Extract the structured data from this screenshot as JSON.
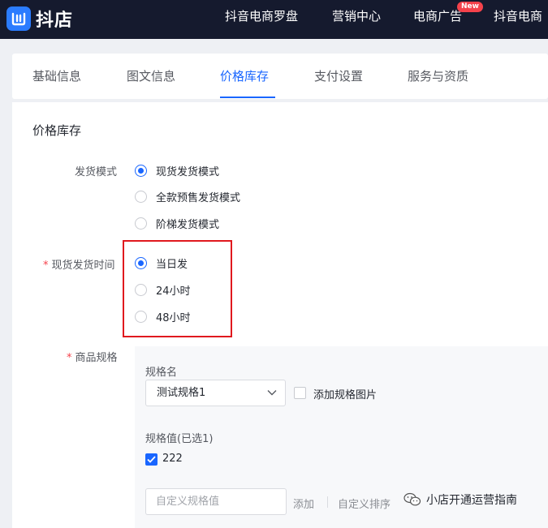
{
  "header": {
    "logo_text": "抖店",
    "nav": [
      "抖音电商罗盘",
      "营销中心",
      "电商广告",
      "抖音电商"
    ],
    "badge": "New"
  },
  "tabs": [
    {
      "label": "基础信息",
      "active": false
    },
    {
      "label": "图文信息",
      "active": false
    },
    {
      "label": "价格库存",
      "active": true
    },
    {
      "label": "支付设置",
      "active": false
    },
    {
      "label": "服务与资质",
      "active": false
    }
  ],
  "section_title": "价格库存",
  "delivery_mode": {
    "label": "发货模式",
    "options": [
      {
        "label": "现货发货模式",
        "checked": true
      },
      {
        "label": "全款预售发货模式",
        "checked": false
      },
      {
        "label": "阶梯发货模式",
        "checked": false
      }
    ]
  },
  "delivery_time": {
    "required_mark": "*",
    "label": "现货发货时间",
    "options": [
      {
        "label": "当日发",
        "checked": true
      },
      {
        "label": "24小时",
        "checked": false
      },
      {
        "label": "48小时",
        "checked": false
      }
    ]
  },
  "spec": {
    "required_mark": "*",
    "label": "商品规格",
    "name_label": "规格名",
    "name_value": "测试规格1",
    "add_image_label": "添加规格图片",
    "values_label": "规格值(已选1)",
    "value_item": "222",
    "custom_placeholder": "自定义规格值",
    "add_label": "添加",
    "sort_label": "自定义排序"
  },
  "watermark": "小店开通运营指南",
  "colors": {
    "accent": "#1966ff",
    "highlight": "#e0191e",
    "topbar": "#151a2e"
  }
}
